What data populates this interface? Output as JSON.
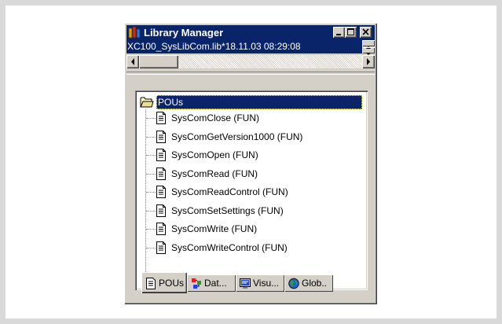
{
  "window": {
    "title": "Library Manager",
    "library_line": "XC100_SysLibCom.lib*18.11.03 08:29:08",
    "buttons": {
      "minimize": "minimize",
      "maximize": "maximize",
      "close": "close"
    }
  },
  "tree": {
    "root_label": "POUs",
    "items": [
      "SysComClose (FUN)",
      "SysComGetVersion1000 (FUN)",
      "SysComOpen (FUN)",
      "SysComRead (FUN)",
      "SysComReadControl (FUN)",
      "SysComSetSettings (FUN)",
      "SysComWrite (FUN)",
      "SysComWriteControl (FUN)"
    ]
  },
  "tabs": [
    {
      "label": "POUs",
      "icon": "document-icon",
      "active": true
    },
    {
      "label": "Dat...",
      "icon": "data-types-icon",
      "active": false
    },
    {
      "label": "Visu...",
      "icon": "visualization-icon",
      "active": false
    },
    {
      "label": "Glob..",
      "icon": "globe-icon",
      "active": false
    }
  ],
  "colors": {
    "title_bar": "#0a246a",
    "selection": "#0a246a",
    "face": "#d4d0c8"
  }
}
